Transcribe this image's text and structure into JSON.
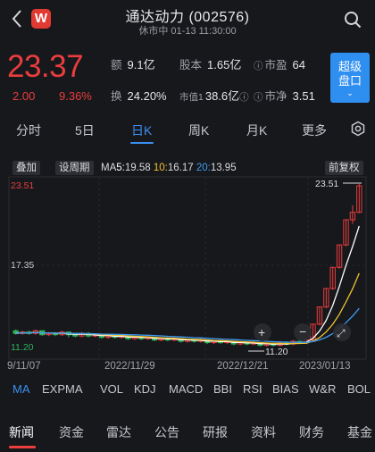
{
  "header": {
    "title": "通达动力 (002576)",
    "subtitle": "休市中 01-13 11:30:00",
    "logo_letter": "W"
  },
  "quote": {
    "price": "23.37",
    "change": "2.00",
    "change_pct": "9.36%",
    "amount_label": "额",
    "amount": "9.1亿",
    "shares_label": "股本",
    "shares": "1.65亿",
    "pe_label": "市盈",
    "pe": "64",
    "turnover_label": "换",
    "turnover": "24.20%",
    "mktcap_label": "市值1",
    "mktcap": "38.6亿",
    "pb_label": "市净",
    "pb": "3.51"
  },
  "super_button": {
    "line1": "超级",
    "line2": "盘口",
    "caret": "⌄"
  },
  "period_tabs": [
    "分时",
    "5日",
    "日K",
    "周K",
    "月K",
    "更多"
  ],
  "active_period": "日K",
  "chart_toolbar": {
    "overlay": "叠加",
    "set_period": "设周期",
    "ma_label": "MA",
    "ma5_key": "5:",
    "ma5": "19.58",
    "ma10_key": "10:",
    "ma10": "16.17",
    "ma20_key": "20:",
    "ma20": "13.95",
    "adjust": "前复权"
  },
  "chart_labels": {
    "y_high": "23.51",
    "y_mid": "17.35",
    "y_low": "11.20",
    "max_marker": "23.51",
    "min_marker": "11.20"
  },
  "x_dates": [
    "9/11/07",
    "2022/11/29",
    "2022/12/21",
    "2023/01/13"
  ],
  "indicators": [
    "MA",
    "EXPMA",
    "VOL",
    "KDJ",
    "MACD",
    "BBI",
    "RSI",
    "BIAS",
    "W&R",
    "BOL"
  ],
  "active_indicator": "MA",
  "bottom_tabs": [
    "新闻",
    "资金",
    "雷达",
    "公告",
    "研报",
    "资料",
    "财务",
    "基金"
  ],
  "active_bottom_tab": "新闻",
  "colors": {
    "up": "#ea3d3d",
    "down": "#2fb35a",
    "accent": "#3b8ff0",
    "ma5": "#ffffff",
    "ma10": "#f0c330",
    "ma20": "#3d9af2"
  },
  "chart_data": {
    "type": "candlestick",
    "ylim": [
      11.2,
      23.51
    ],
    "x_labels": [
      "9/11/07",
      "2022/11/29",
      "2022/12/21",
      "2023/01/13"
    ],
    "high_marker": 23.51,
    "low_marker": 11.2,
    "series": [
      {
        "name": "MA5",
        "value": 19.58
      },
      {
        "name": "MA10",
        "value": 16.17
      },
      {
        "name": "MA20",
        "value": 13.95
      }
    ],
    "candles": [
      [
        12.4,
        12.2,
        12.5,
        12.1
      ],
      [
        12.2,
        12.3,
        12.4,
        12.1
      ],
      [
        12.3,
        12.2,
        12.4,
        12.1
      ],
      [
        12.2,
        12.4,
        12.5,
        12.1
      ],
      [
        12.4,
        12.1,
        12.4,
        12.0
      ],
      [
        12.1,
        12.2,
        12.3,
        12.0
      ],
      [
        12.2,
        12.1,
        12.3,
        12.0
      ],
      [
        12.1,
        12.3,
        12.4,
        12.0
      ],
      [
        12.3,
        12.1,
        12.3,
        11.9
      ],
      [
        12.1,
        12.0,
        12.2,
        11.9
      ],
      [
        12.0,
        12.2,
        12.3,
        11.9
      ],
      [
        12.2,
        12.0,
        12.3,
        11.9
      ],
      [
        12.0,
        12.1,
        12.2,
        11.9
      ],
      [
        12.1,
        11.9,
        12.1,
        11.8
      ],
      [
        11.9,
        12.0,
        12.1,
        11.8
      ],
      [
        12.0,
        11.9,
        12.1,
        11.8
      ],
      [
        11.9,
        12.0,
        12.1,
        11.8
      ],
      [
        12.0,
        11.8,
        12.0,
        11.7
      ],
      [
        11.8,
        11.9,
        12.0,
        11.7
      ],
      [
        11.9,
        11.8,
        12.0,
        11.7
      ],
      [
        11.8,
        11.9,
        12.0,
        11.7
      ],
      [
        11.9,
        11.7,
        11.9,
        11.6
      ],
      [
        11.7,
        11.8,
        11.9,
        11.6
      ],
      [
        11.8,
        11.7,
        11.9,
        11.6
      ],
      [
        11.7,
        11.8,
        11.9,
        11.6
      ],
      [
        11.8,
        11.6,
        11.8,
        11.5
      ],
      [
        11.6,
        11.7,
        11.8,
        11.5
      ],
      [
        11.7,
        11.6,
        11.8,
        11.5
      ],
      [
        11.6,
        11.7,
        11.8,
        11.5
      ],
      [
        11.7,
        11.5,
        11.7,
        11.4
      ],
      [
        11.5,
        11.6,
        11.7,
        11.4
      ],
      [
        11.6,
        11.5,
        11.7,
        11.4
      ],
      [
        11.5,
        11.6,
        11.7,
        11.4
      ],
      [
        11.6,
        11.4,
        11.6,
        11.3
      ],
      [
        11.4,
        11.5,
        11.6,
        11.3
      ],
      [
        11.5,
        11.4,
        11.5,
        11.3
      ],
      [
        11.4,
        11.5,
        11.6,
        11.3
      ],
      [
        11.5,
        11.3,
        11.5,
        11.2
      ],
      [
        11.3,
        11.4,
        11.5,
        11.2
      ],
      [
        11.4,
        11.3,
        11.5,
        11.2
      ],
      [
        11.3,
        11.5,
        11.6,
        11.2
      ],
      [
        11.5,
        11.4,
        11.6,
        11.3
      ],
      [
        11.4,
        11.6,
        11.7,
        11.3
      ],
      [
        11.6,
        11.5,
        11.7,
        11.4
      ],
      [
        11.5,
        11.7,
        11.8,
        11.4
      ],
      [
        11.7,
        12.9,
        12.9,
        11.7
      ],
      [
        12.9,
        14.2,
        14.2,
        12.8
      ],
      [
        14.2,
        15.6,
        15.6,
        14.1
      ],
      [
        15.6,
        17.2,
        17.2,
        15.5
      ],
      [
        17.2,
        18.9,
        18.9,
        17.1
      ],
      [
        18.9,
        20.8,
        20.8,
        18.8
      ],
      [
        20.8,
        21.37,
        21.9,
        20.5
      ],
      [
        21.37,
        23.37,
        23.51,
        21.3
      ]
    ]
  }
}
